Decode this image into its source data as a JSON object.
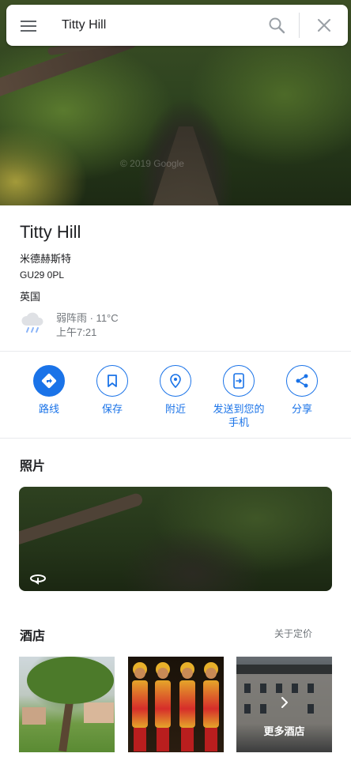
{
  "search": {
    "query": "Titty Hill"
  },
  "hero": {
    "watermark": "© 2019 Google"
  },
  "place": {
    "title": "Titty Hill",
    "address_line1": "米德赫斯特",
    "address_line2": "GU29 0PL",
    "address_line3": "英国"
  },
  "weather": {
    "icon": "rain-cloud-icon",
    "condition": "弱阵雨 · 11°C",
    "time": "上午7:21"
  },
  "actions": [
    {
      "label": "路线",
      "icon": "directions-icon"
    },
    {
      "label": "保存",
      "icon": "bookmark-icon"
    },
    {
      "label": "附近",
      "icon": "nearby-icon"
    },
    {
      "label": "发送到您的手机",
      "icon": "send-to-phone-icon"
    },
    {
      "label": "分享",
      "icon": "share-icon"
    }
  ],
  "photos": {
    "title": "照片",
    "icon": "street-view-icon"
  },
  "hotels": {
    "title": "酒店",
    "pricing_link": "关于定价",
    "more_label": "更多酒店"
  },
  "colors": {
    "accent": "#1a73e8",
    "secondary_text": "#70757a",
    "divider": "#e8eaed"
  }
}
